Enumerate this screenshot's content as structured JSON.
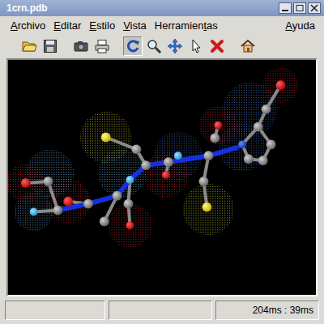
{
  "window": {
    "title": "1crn.pdb"
  },
  "menu": [
    {
      "label": "Archivo",
      "mnemonic": 0
    },
    {
      "label": "Editar",
      "mnemonic": 0
    },
    {
      "label": "Estilo",
      "mnemonic": 0
    },
    {
      "label": "Vista",
      "mnemonic": 0
    },
    {
      "label": "Herramientas",
      "mnemonic": 9
    }
  ],
  "help_menu": {
    "label": "Ayuda",
    "mnemonic": 0
  },
  "toolbar": [
    {
      "kind": "open",
      "selected": false
    },
    {
      "kind": "save",
      "selected": false
    },
    {
      "kind": "separator",
      "selected": false
    },
    {
      "kind": "camera",
      "selected": false
    },
    {
      "kind": "print",
      "selected": false
    },
    {
      "kind": "separator",
      "selected": false
    },
    {
      "kind": "rotate",
      "selected": true
    },
    {
      "kind": "zoom",
      "selected": false
    },
    {
      "kind": "move",
      "selected": false
    },
    {
      "kind": "pick",
      "selected": false
    },
    {
      "kind": "delete",
      "selected": false
    },
    {
      "kind": "separator",
      "selected": false
    },
    {
      "kind": "home",
      "selected": false
    }
  ],
  "status_bar": {
    "fields": [
      "",
      "",
      "204ms : 39ms"
    ]
  }
}
